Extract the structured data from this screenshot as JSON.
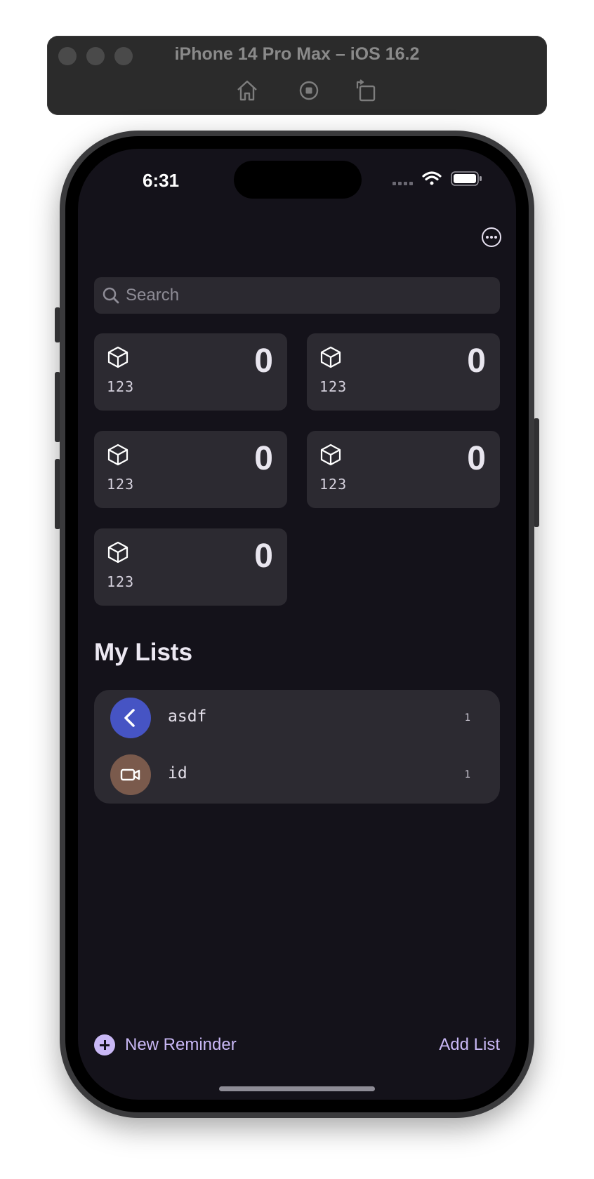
{
  "simulator": {
    "title": "iPhone 14 Pro Max – iOS 16.2",
    "tools": [
      "home-icon",
      "screenshot-icon",
      "rotate-icon"
    ]
  },
  "status_bar": {
    "time": "6:31",
    "icons": [
      "signal-icon",
      "wifi-icon",
      "battery-icon"
    ]
  },
  "header": {
    "more_icon": "ellipsis-circle-icon"
  },
  "search": {
    "placeholder": "Search"
  },
  "smart_lists": [
    {
      "label": "123",
      "count": "0",
      "icon": "cube-icon"
    },
    {
      "label": "123",
      "count": "0",
      "icon": "cube-icon"
    },
    {
      "label": "123",
      "count": "0",
      "icon": "cube-icon"
    },
    {
      "label": "123",
      "count": "0",
      "icon": "cube-icon"
    },
    {
      "label": "123",
      "count": "0",
      "icon": "cube-icon"
    }
  ],
  "my_lists": {
    "title": "My Lists",
    "items": [
      {
        "name": "asdf",
        "count": "1",
        "icon": "chevron-left-icon",
        "color": "#4654c4"
      },
      {
        "name": "id",
        "count": "1",
        "icon": "video-camera-icon",
        "color": "#7a5a4c"
      }
    ]
  },
  "toolbar": {
    "new_reminder": "New Reminder",
    "add_list": "Add List"
  },
  "colors": {
    "background": "#14121a",
    "card": "#2c2a31",
    "accent": "#c9b8f5"
  }
}
